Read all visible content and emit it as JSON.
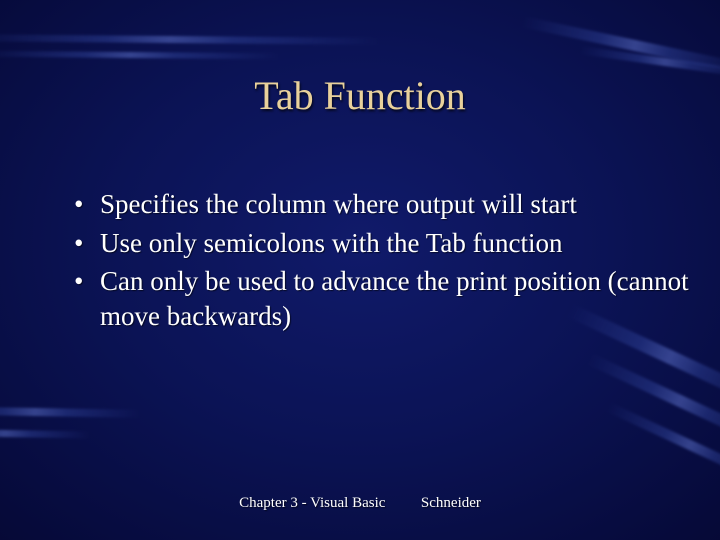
{
  "title": "Tab Function",
  "bullets": [
    "Specifies the column where output will start",
    "Use only semicolons with the Tab function",
    "Can only be used to advance the print position (cannot move backwards)"
  ],
  "footer": {
    "left": "Chapter 3 - Visual Basic",
    "right": "Schneider"
  }
}
